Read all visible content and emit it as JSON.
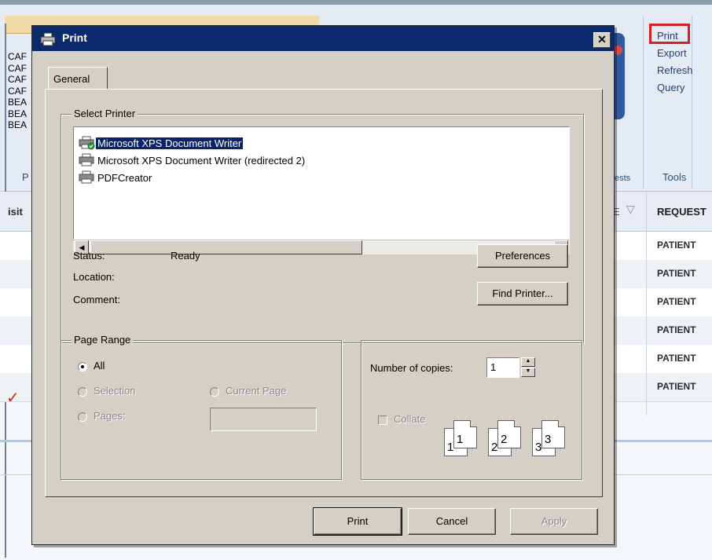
{
  "background_app": {
    "left_codes": [
      "CAF",
      "CAF",
      "CAF",
      "CAF",
      "BEA",
      "BEA",
      "BEA"
    ],
    "ribbon_letter": "P",
    "ests_label": "ests",
    "tools_menu": [
      "Print",
      "Export",
      "Refresh",
      "Query"
    ],
    "tools_group_label": "Tools",
    "grid": {
      "left_header": "isit",
      "mid_header": "E",
      "right_header": "REQUEST",
      "rows": [
        "PATIENT",
        "PATIENT",
        "PATIENT",
        "PATIENT",
        "PATIENT",
        "PATIENT"
      ]
    },
    "highlight_color": "#d42020"
  },
  "dialog": {
    "title": "Print",
    "close_label": "✕",
    "tab_label": "General",
    "select_printer": {
      "legend": "Select Printer",
      "printers": [
        {
          "name": "Microsoft XPS Document Writer",
          "selected": true,
          "icon": "default-printer-icon"
        },
        {
          "name": "Microsoft XPS Document Writer (redirected 2)",
          "selected": false,
          "icon": "printer-icon"
        },
        {
          "name": "PDFCreator",
          "selected": false,
          "icon": "printer-icon"
        }
      ],
      "status_label": "Status:",
      "status_value": "Ready",
      "location_label": "Location:",
      "comment_label": "Comment:",
      "preferences_button": "Preferences",
      "find_printer_button": "Find Printer..."
    },
    "page_range": {
      "legend": "Page Range",
      "all_label": "All",
      "selection_label": "Selection",
      "current_page_label": "Current Page",
      "pages_label": "Pages:",
      "pages_value": "",
      "selected_option": "All"
    },
    "copies": {
      "number_label": "Number of copies:",
      "number_value": "1",
      "collate_label": "Collate",
      "collate_checked": false,
      "page_icons": [
        "1",
        "1",
        "2",
        "2",
        "3",
        "3"
      ]
    },
    "buttons": {
      "print": "Print",
      "cancel": "Cancel",
      "apply": "Apply"
    }
  }
}
